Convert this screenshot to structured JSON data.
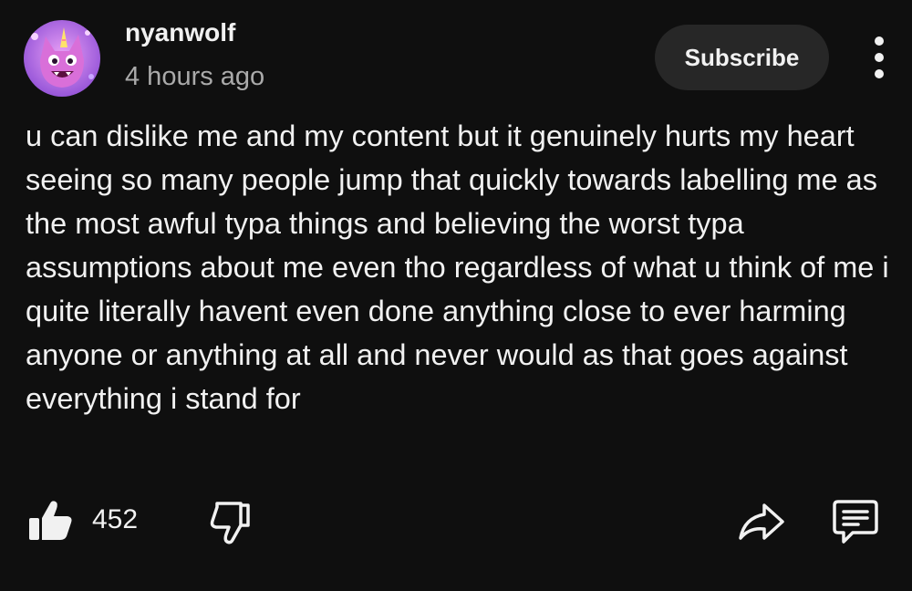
{
  "post": {
    "author": {
      "name": "nyanwolf",
      "avatar_icon": "avatar-pink-wolf-icon"
    },
    "time": "4 hours ago",
    "subscribe_label": "Subscribe",
    "text": "u can dislike me and my content but it genuinely hurts my heart seeing so many people jump that quickly towards labelling me as the most awful typa things and believing the worst typa assumptions about me even tho regardless of what u think of me i quite literally havent even done anything close to ever harming anyone or anything at all and never would as that goes against everything i stand for",
    "actions": {
      "like_count": "452",
      "like_icon": "thumbs-up-icon",
      "dislike_icon": "thumbs-down-icon",
      "share_icon": "share-icon",
      "comment_icon": "comment-icon"
    }
  },
  "colors": {
    "background": "#0f0f0f",
    "text": "#f1f1f1",
    "secondary_text": "#aaaaaa",
    "subscribe_bg": "#272727"
  }
}
